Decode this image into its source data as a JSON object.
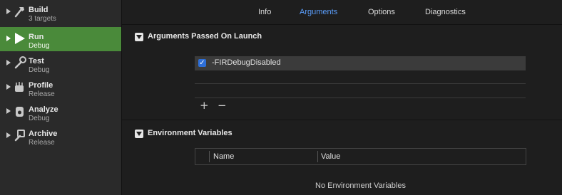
{
  "sidebar": {
    "schemes": [
      {
        "title": "Build",
        "subtitle": "3 targets",
        "icon": "hammer-icon",
        "selected": false
      },
      {
        "title": "Run",
        "subtitle": "Debug",
        "icon": "play-icon",
        "selected": true
      },
      {
        "title": "Test",
        "subtitle": "Debug",
        "icon": "wrench-icon",
        "selected": false
      },
      {
        "title": "Profile",
        "subtitle": "Release",
        "icon": "gauge-icon",
        "selected": false
      },
      {
        "title": "Analyze",
        "subtitle": "Debug",
        "icon": "analyze-icon",
        "selected": false
      },
      {
        "title": "Archive",
        "subtitle": "Release",
        "icon": "archive-icon",
        "selected": false
      }
    ]
  },
  "tabs": [
    {
      "label": "Info",
      "active": false
    },
    {
      "label": "Arguments",
      "active": true
    },
    {
      "label": "Options",
      "active": false
    },
    {
      "label": "Diagnostics",
      "active": false
    }
  ],
  "arguments": {
    "section_title": "Arguments Passed On Launch",
    "items": [
      {
        "text": "-FIRDebugDisabled",
        "checked": true
      }
    ],
    "add_label": "+",
    "remove_label": "−"
  },
  "environment": {
    "section_title": "Environment Variables",
    "columns": [
      "Name",
      "Value"
    ],
    "empty_text": "No Environment Variables"
  },
  "colors": {
    "selected_scheme": "#4a8a3a",
    "active_tab": "#5a9dfa",
    "checkbox": "#2e6fd8"
  }
}
